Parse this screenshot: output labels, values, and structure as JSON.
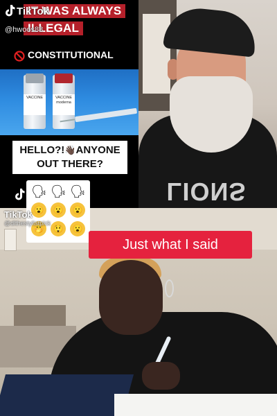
{
  "top_left_panel": {
    "banner_line1": "IT WAS ALWAYS",
    "banner_line2": "ILLEGAL",
    "tiktok_label": "TikTok",
    "handle": "@hwoos88",
    "constitutional_text": "CONSTITUTIONAL",
    "vial1_label": "VACCINE",
    "vial2_label": "VACCINE moderna",
    "hello_line1": "HELLO?!",
    "hello_wave": "👋🏿",
    "hello_line1_rest": "ANYONE",
    "hello_line2": "OUT THERE?"
  },
  "top_right_panel": {
    "shirt_print": "LIONS"
  },
  "bottom_panel": {
    "tiktok_label": "TikTok",
    "handle": "@dlthestylistpick",
    "caption": "Just what I said",
    "emoji_row1": [
      "🗣",
      "🗣",
      "🗣"
    ],
    "emoji_row2": [
      "😮",
      "😮",
      "😮"
    ],
    "emoji_row3": [
      "🤭",
      "😲",
      "😮"
    ]
  },
  "colors": {
    "banner_red": "#b5202a",
    "caption_red": "#e5223e",
    "background": "#000000"
  }
}
